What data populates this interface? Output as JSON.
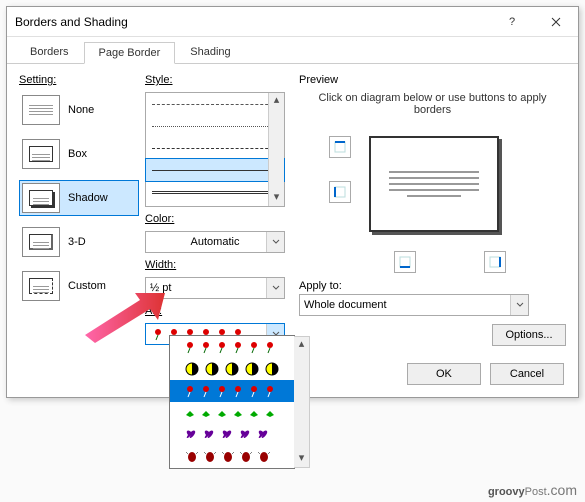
{
  "title": "Borders and Shading",
  "tabs": {
    "borders": "Borders",
    "page_border": "Page Border",
    "shading": "Shading"
  },
  "setting": {
    "label": "Setting:",
    "items": [
      {
        "label": "None"
      },
      {
        "label": "Box"
      },
      {
        "label": "Shadow"
      },
      {
        "label": "3-D"
      },
      {
        "label": "Custom"
      }
    ]
  },
  "style": {
    "label": "Style:"
  },
  "color": {
    "label": "Color:",
    "value": "Automatic"
  },
  "width": {
    "label": "Width:",
    "value": "½ pt"
  },
  "art": {
    "label": "Art:"
  },
  "preview": {
    "label": "Preview",
    "hint": "Click on diagram below or use buttons to apply borders"
  },
  "apply": {
    "label": "Apply to:",
    "value": "Whole document"
  },
  "buttons": {
    "options": "Options...",
    "ok": "OK",
    "cancel": "Cancel"
  },
  "watermark": "groovyPost.com"
}
